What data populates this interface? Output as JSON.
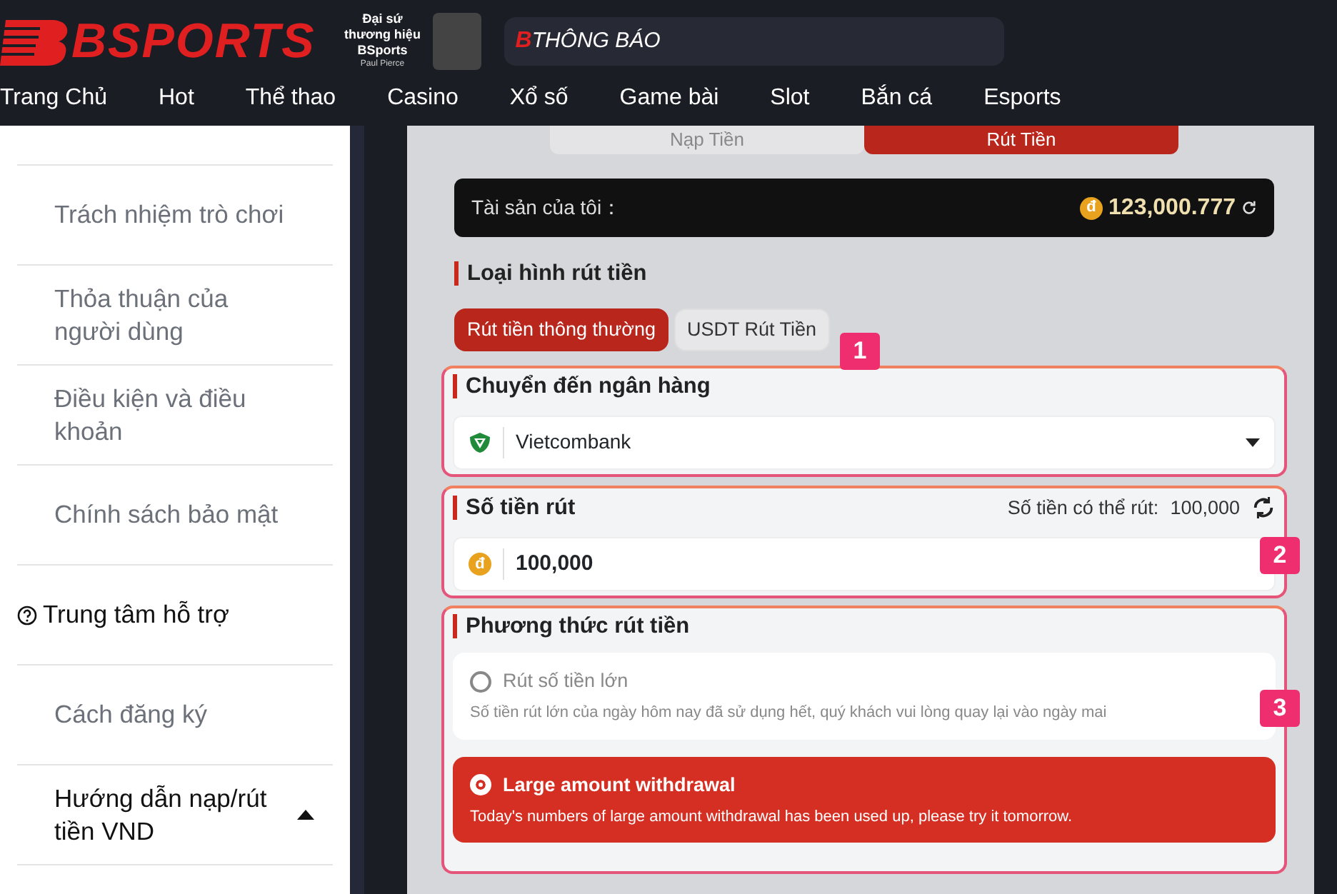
{
  "header": {
    "logo": "BSPORTS",
    "ambassador": {
      "title": "Đại sứ thương hiệu BSports",
      "name": "Paul Pierce"
    },
    "notice": {
      "mark": "B",
      "text": "THÔNG BÁO"
    }
  },
  "nav": [
    "Trang Chủ",
    "Hot",
    "Thể thao",
    "Casino",
    "Xổ số",
    "Game bài",
    "Slot",
    "Bắn cá",
    "Esports"
  ],
  "sidebar": {
    "items": [
      {
        "kind": "item",
        "label": "Trách nhiệm trò chơi"
      },
      {
        "kind": "item",
        "label": "Thỏa thuận của người dùng"
      },
      {
        "kind": "item",
        "label": "Điều kiện và điều khoản"
      },
      {
        "kind": "item",
        "label": "Chính sách bảo mật"
      },
      {
        "kind": "section",
        "label": "Trung tâm hỗ trợ"
      },
      {
        "kind": "item",
        "label": "Cách đăng ký"
      },
      {
        "kind": "item",
        "label": "Hướng dẫn nạp/rút tiền VND",
        "expanded": true
      }
    ]
  },
  "tabs": [
    {
      "label": "Nạp Tiền",
      "selected": false
    },
    {
      "label": "Rút Tiền",
      "selected": true
    }
  ],
  "balance": {
    "label": "Tài sản của tôi：",
    "currency": "đ",
    "amount": "123,000.777"
  },
  "withdraw_type": {
    "title": "Loại hình rút tiền",
    "options": [
      {
        "label": "Rút tiền thông thường",
        "selected": true
      },
      {
        "label": "USDT Rút Tiền",
        "selected": false
      }
    ]
  },
  "bank": {
    "badge": "1",
    "title": "Chuyển đến ngân hàng",
    "value": "Vietcombank"
  },
  "amount": {
    "badge": "2",
    "title": "Số tiền rút",
    "available_label": "Số tiền có thể rút:",
    "available": "100,000",
    "currency": "đ",
    "value": "100,000"
  },
  "method": {
    "badge": "3",
    "title": "Phương thức rút tiền",
    "options": [
      {
        "label": "Rút số tiền lớn",
        "note": "Số tiền rút lớn của ngày hôm nay đã sử dụng hết, quý khách vui lòng quay lại vào ngày mai",
        "selected": false
      },
      {
        "label": "Large amount withdrawal",
        "note": "Today's numbers of large amount withdrawal has been used up, please try it tomorrow.",
        "selected": true
      }
    ]
  }
}
